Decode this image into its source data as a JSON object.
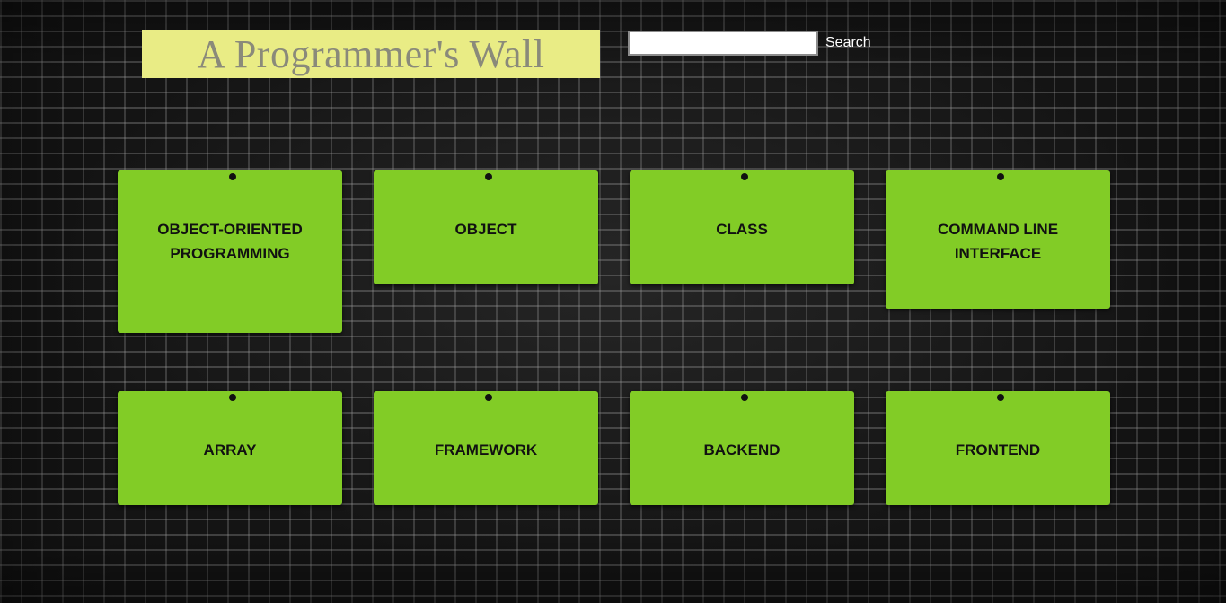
{
  "header": {
    "title": "A Programmer's Wall"
  },
  "search": {
    "value": "",
    "placeholder": "",
    "button_label": "Search"
  },
  "cards": [
    {
      "label": "OBJECT-ORIENTED PROGRAMMING"
    },
    {
      "label": "OBJECT"
    },
    {
      "label": "CLASS"
    },
    {
      "label": "COMMAND LINE INTERFACE"
    },
    {
      "label": "ARRAY"
    },
    {
      "label": "FRAMEWORK"
    },
    {
      "label": "BACKEND"
    },
    {
      "label": "FRONTEND"
    }
  ],
  "colors": {
    "title_background": "#e9ec85",
    "title_text": "#8a8a7a",
    "card_background": "#82cc26",
    "wall_background": "#141414"
  }
}
